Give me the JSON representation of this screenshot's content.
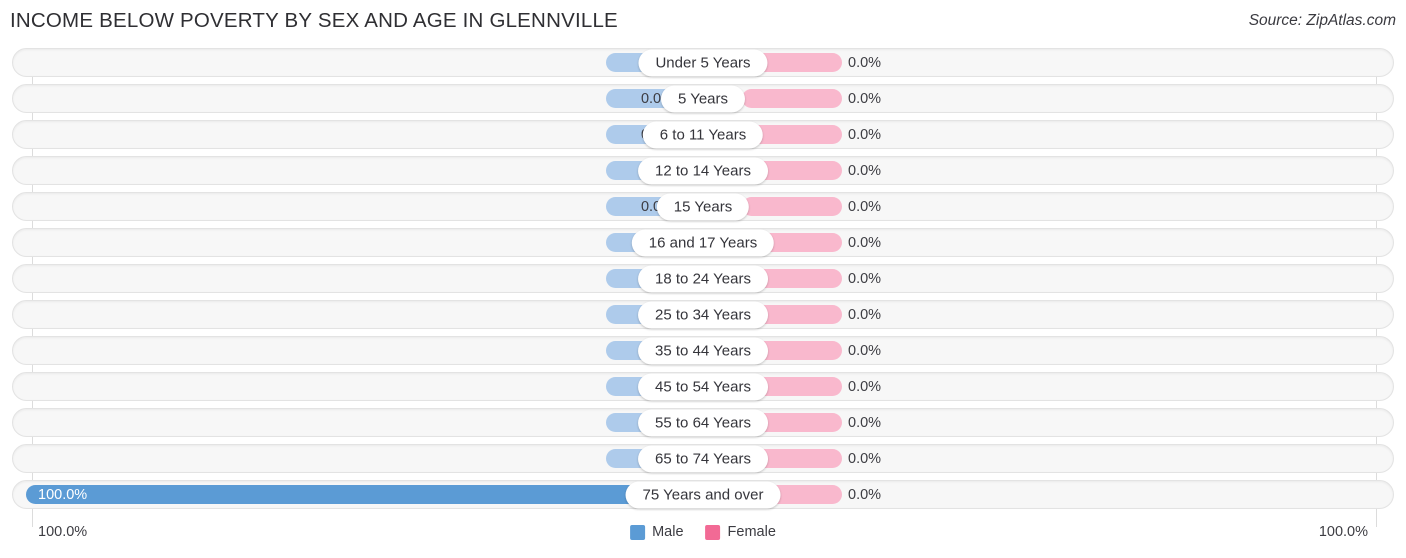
{
  "header": {
    "title": "INCOME BELOW POVERTY BY SEX AND AGE IN GLENNVILLE",
    "source": "Source: ZipAtlas.com"
  },
  "legend": {
    "male_label": "Male",
    "female_label": "Female",
    "male_color": "#5b9bd5",
    "female_color": "#f26a95"
  },
  "axis": {
    "left_label": "100.0%",
    "right_label": "100.0%"
  },
  "colors": {
    "male_bar": "#aecbeb",
    "female_bar": "#f9b8cd",
    "male_bar_full": "#5b9bd5",
    "track": "#f7f7f7"
  },
  "chart_data": {
    "type": "bar",
    "title": "INCOME BELOW POVERTY BY SEX AND AGE IN GLENNVILLE",
    "subtitle": "Source: ZipAtlas.com",
    "orientation": "horizontal",
    "style": "diverging-population-pyramid",
    "xlabel": "",
    "ylabel": "",
    "xlim": [
      0,
      100
    ],
    "grid": true,
    "legend_position": "bottom-center",
    "categories": [
      "Under 5 Years",
      "5 Years",
      "6 to 11 Years",
      "12 to 14 Years",
      "15 Years",
      "16 and 17 Years",
      "18 to 24 Years",
      "25 to 34 Years",
      "35 to 44 Years",
      "45 to 54 Years",
      "55 to 64 Years",
      "65 to 74 Years",
      "75 Years and over"
    ],
    "series": [
      {
        "name": "Male",
        "values": [
          0.0,
          0.0,
          0.0,
          0.0,
          0.0,
          0.0,
          0.0,
          0.0,
          0.0,
          0.0,
          0.0,
          0.0,
          100.0
        ]
      },
      {
        "name": "Female",
        "values": [
          0.0,
          0.0,
          0.0,
          0.0,
          0.0,
          0.0,
          0.0,
          0.0,
          0.0,
          0.0,
          0.0,
          0.0,
          0.0
        ]
      }
    ]
  },
  "rows": [
    {
      "label": "Under 5 Years",
      "male": "0.0%",
      "female": "0.0%",
      "male_full": false
    },
    {
      "label": "5 Years",
      "male": "0.0%",
      "female": "0.0%",
      "male_full": false
    },
    {
      "label": "6 to 11 Years",
      "male": "0.0%",
      "female": "0.0%",
      "male_full": false
    },
    {
      "label": "12 to 14 Years",
      "male": "0.0%",
      "female": "0.0%",
      "male_full": false
    },
    {
      "label": "15 Years",
      "male": "0.0%",
      "female": "0.0%",
      "male_full": false
    },
    {
      "label": "16 and 17 Years",
      "male": "0.0%",
      "female": "0.0%",
      "male_full": false
    },
    {
      "label": "18 to 24 Years",
      "male": "0.0%",
      "female": "0.0%",
      "male_full": false
    },
    {
      "label": "25 to 34 Years",
      "male": "0.0%",
      "female": "0.0%",
      "male_full": false
    },
    {
      "label": "35 to 44 Years",
      "male": "0.0%",
      "female": "0.0%",
      "male_full": false
    },
    {
      "label": "45 to 54 Years",
      "male": "0.0%",
      "female": "0.0%",
      "male_full": false
    },
    {
      "label": "55 to 64 Years",
      "male": "0.0%",
      "female": "0.0%",
      "male_full": false
    },
    {
      "label": "65 to 74 Years",
      "male": "0.0%",
      "female": "0.0%",
      "male_full": false
    },
    {
      "label": "75 Years and over",
      "male": "100.0%",
      "female": "0.0%",
      "male_full": true
    }
  ]
}
